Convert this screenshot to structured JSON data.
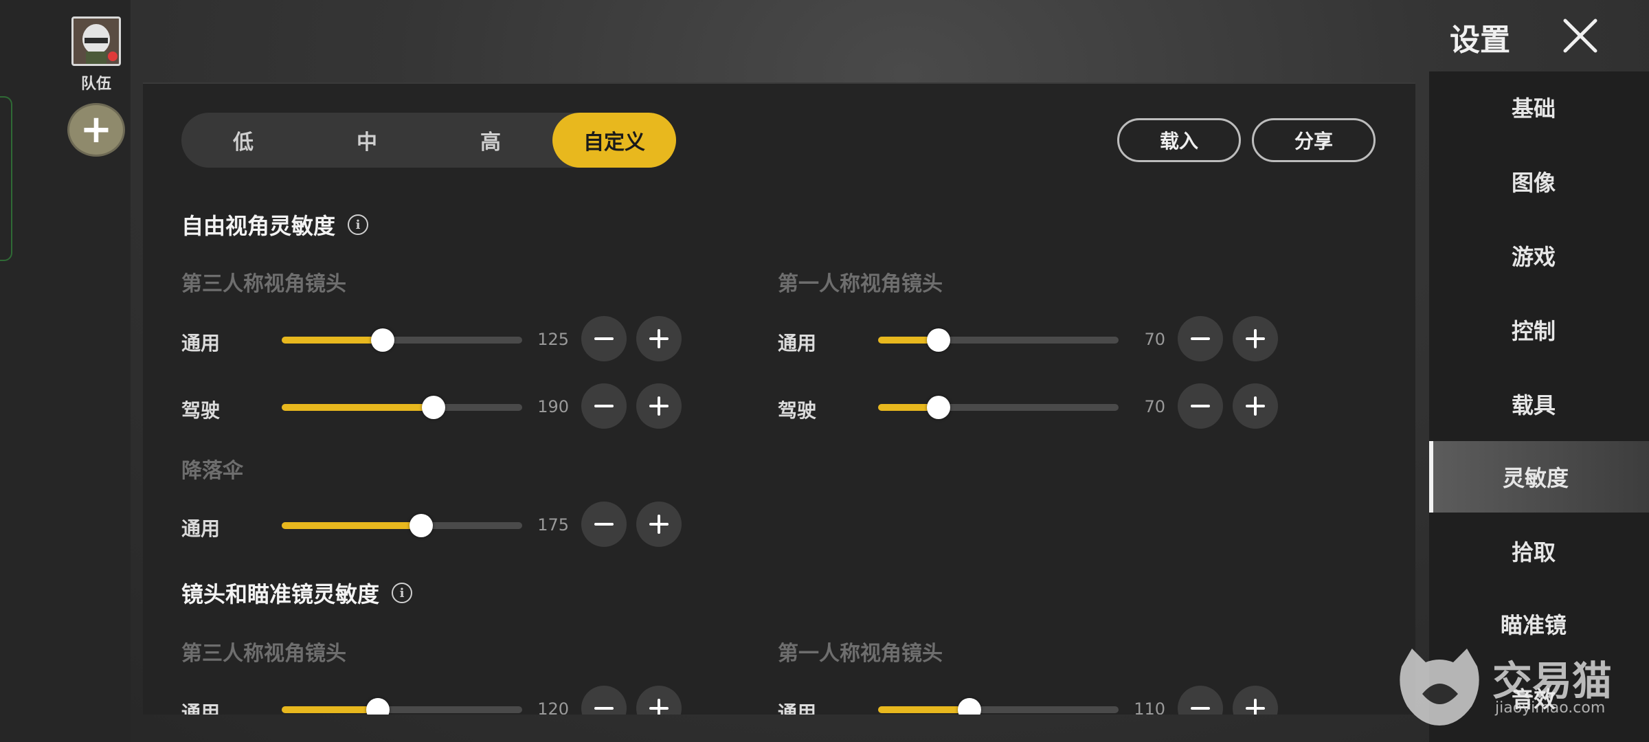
{
  "team": {
    "label": "队伍",
    "add_symbol": "+"
  },
  "header": {
    "title": "设置"
  },
  "presets": [
    {
      "label": "低",
      "active": false
    },
    {
      "label": "中",
      "active": false
    },
    {
      "label": "高",
      "active": false
    },
    {
      "label": "自定义",
      "active": true
    }
  ],
  "actions": {
    "load": "载入",
    "share": "分享"
  },
  "sections": {
    "free_look": {
      "title": "自由视角灵敏度",
      "info": "i",
      "tpp": {
        "title": "第三人称视角镜头",
        "rows": [
          {
            "label": "通用",
            "value": "125",
            "level": 0.42
          },
          {
            "label": "驾驶",
            "value": "190",
            "level": 0.63
          }
        ]
      },
      "fpp": {
        "title": "第一人称视角镜头",
        "rows": [
          {
            "label": "通用",
            "value": "70",
            "level": 0.25
          },
          {
            "label": "驾驶",
            "value": "70",
            "level": 0.25
          }
        ]
      },
      "parachute": {
        "title": "降落伞",
        "rows": [
          {
            "label": "通用",
            "value": "175",
            "level": 0.58
          }
        ]
      }
    },
    "camera_scope": {
      "title": "镜头和瞄准镜灵敏度",
      "info": "i",
      "tpp": {
        "title": "第三人称视角镜头",
        "rows": [
          {
            "label": "通用",
            "value": "120",
            "level": 0.4
          }
        ]
      },
      "fpp": {
        "title": "第一人称视角镜头",
        "rows": [
          {
            "label": "通用",
            "value": "110",
            "level": 0.38
          }
        ]
      }
    }
  },
  "nav": {
    "items": [
      {
        "label": "基础",
        "active": false
      },
      {
        "label": "图像",
        "active": false
      },
      {
        "label": "游戏",
        "active": false
      },
      {
        "label": "控制",
        "active": false
      },
      {
        "label": "载具",
        "active": false
      },
      {
        "label": "灵敏度",
        "active": true
      },
      {
        "label": "拾取",
        "active": false
      },
      {
        "label": "瞄准镜",
        "active": false
      },
      {
        "label": "音效",
        "active": false
      }
    ]
  },
  "watermark": {
    "name": "交易猫",
    "url": "jiaoyimao.com"
  },
  "colors": {
    "accent": "#e8b81e",
    "track": "#4a4a4a",
    "panel": "#242424"
  }
}
